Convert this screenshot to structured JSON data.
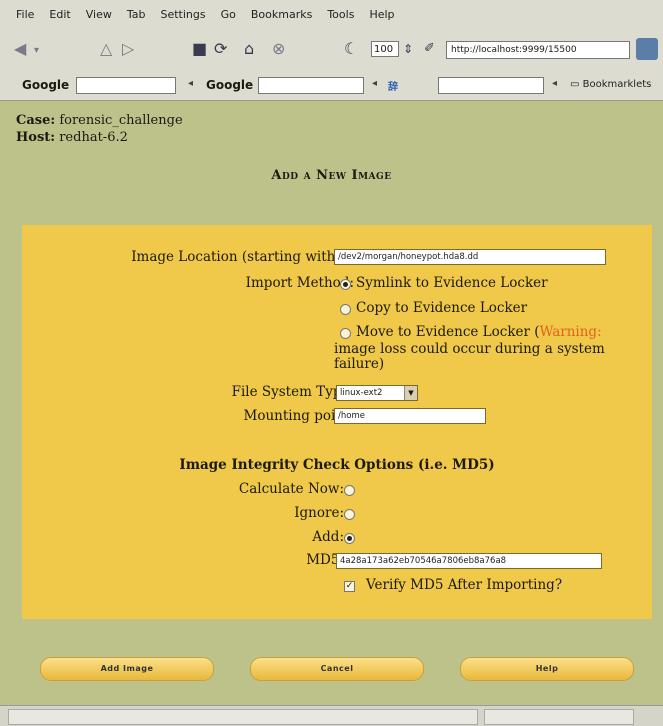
{
  "menu": [
    "File",
    "Edit",
    "View",
    "Tab",
    "Settings",
    "Go",
    "Bookmarks",
    "Tools",
    "Help"
  ],
  "toolbar": {
    "zoom_value": "100",
    "url": "http://localhost:9999/15500"
  },
  "searchbar": {
    "google_label_1": "Google",
    "google_label_2": "Google",
    "bookmarklets_label": "Bookmarklets"
  },
  "case": {
    "case_label": "Case:",
    "case_value": "forensic_challenge",
    "host_label": "Host:",
    "host_value": "redhat-6.2"
  },
  "page_title": "Add a New Image",
  "form": {
    "image_location_label": "Image Location (starting with /):",
    "image_location_value": "/dev2/morgan/honeypot.hda8.dd",
    "import_method_label": "Import Method:",
    "import_options": {
      "symlink": "Symlink to Evidence Locker",
      "copy": "Copy to Evidence Locker",
      "move": "Move to Evidence Locker (",
      "move_warning": "Warning:",
      "move_note": "image loss could occur during a system failure)"
    },
    "fs_type_label": "File System Type:",
    "fs_type_value": "linux-ext2",
    "mount_label": "Mounting point:",
    "mount_value": "/home",
    "integrity_heading": "Image Integrity Check Options (i.e. MD5)",
    "calc_now_label": "Calculate Now:",
    "ignore_label": "Ignore:",
    "add_label": "Add:",
    "md5_label": "MD5:",
    "md5_value": "4a28a173a62eb70546a7806eb8a76a8",
    "verify_label": "Verify MD5 After Importing?"
  },
  "buttons": {
    "add": "Add Image",
    "cancel": "Cancel",
    "help": "Help"
  }
}
